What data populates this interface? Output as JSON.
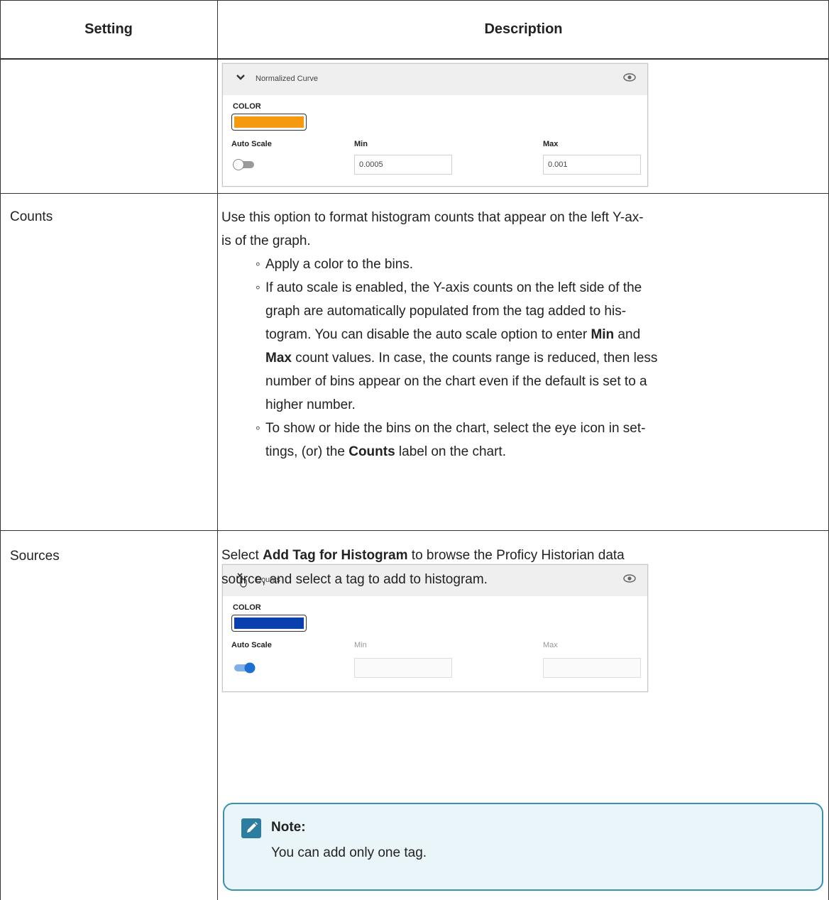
{
  "header": {
    "setting": "Setting",
    "description": "Description"
  },
  "panel_normalized": {
    "title": "Normalized Curve",
    "color_label": "COLOR",
    "color_value": "#f59a0c",
    "auto_scale_label": "Auto Scale",
    "auto_scale_on": false,
    "min_label": "Min",
    "min_value": "0.0005",
    "max_label": "Max",
    "max_value": "0.001"
  },
  "counts": {
    "setting": "Counts",
    "intro_line1": "Use this option to format histogram counts that appear on the left Y-ax-",
    "intro_line2": "is of the graph.",
    "bullet1": "Apply a color to the bins.",
    "bullet2_l1": "If auto scale is enabled, the Y-axis counts on the left side of the",
    "bullet2_l2": "graph are automatically populated from the tag added to his-",
    "bullet2_l3a": "togram. You can disable the auto scale option to enter ",
    "bullet2_min": "Min",
    "bullet2_l3b": " and",
    "bullet2_max": "Max",
    "bullet2_l4": " count values. In case, the counts range is reduced, then less",
    "bullet2_l5": "number of bins appear on the chart even if the default is set to a",
    "bullet2_l6": "higher number.",
    "bullet3_l1": "To show or hide the bins on the chart, select the eye icon in set-",
    "bullet3_l2a": "tings, (or) the ",
    "bullet3_counts": "Counts",
    "bullet3_l2b": " label on the chart."
  },
  "panel_counts": {
    "title": "Counts",
    "color_label": "COLOR",
    "color_value": "#0a3fae",
    "auto_scale_label": "Auto Scale",
    "auto_scale_on": true,
    "min_label": "Min",
    "max_label": "Max"
  },
  "sources": {
    "setting": "Sources",
    "l1a": "Select ",
    "l1b": "Add Tag for Histogram",
    "l1c": " to browse the Proficy Historian data",
    "l2": "source, and select a tag to add to histogram.",
    "note_title": "Note:",
    "note_body": "You can add only one tag."
  },
  "colors": {
    "note_border": "#3d8fae",
    "note_bg": "#e9f5f8",
    "toggle_on": "#1d6fd1"
  },
  "icons": [
    "chevron-down-icon",
    "eye-icon",
    "hand-pointer-icon",
    "pencil-note-icon"
  ]
}
